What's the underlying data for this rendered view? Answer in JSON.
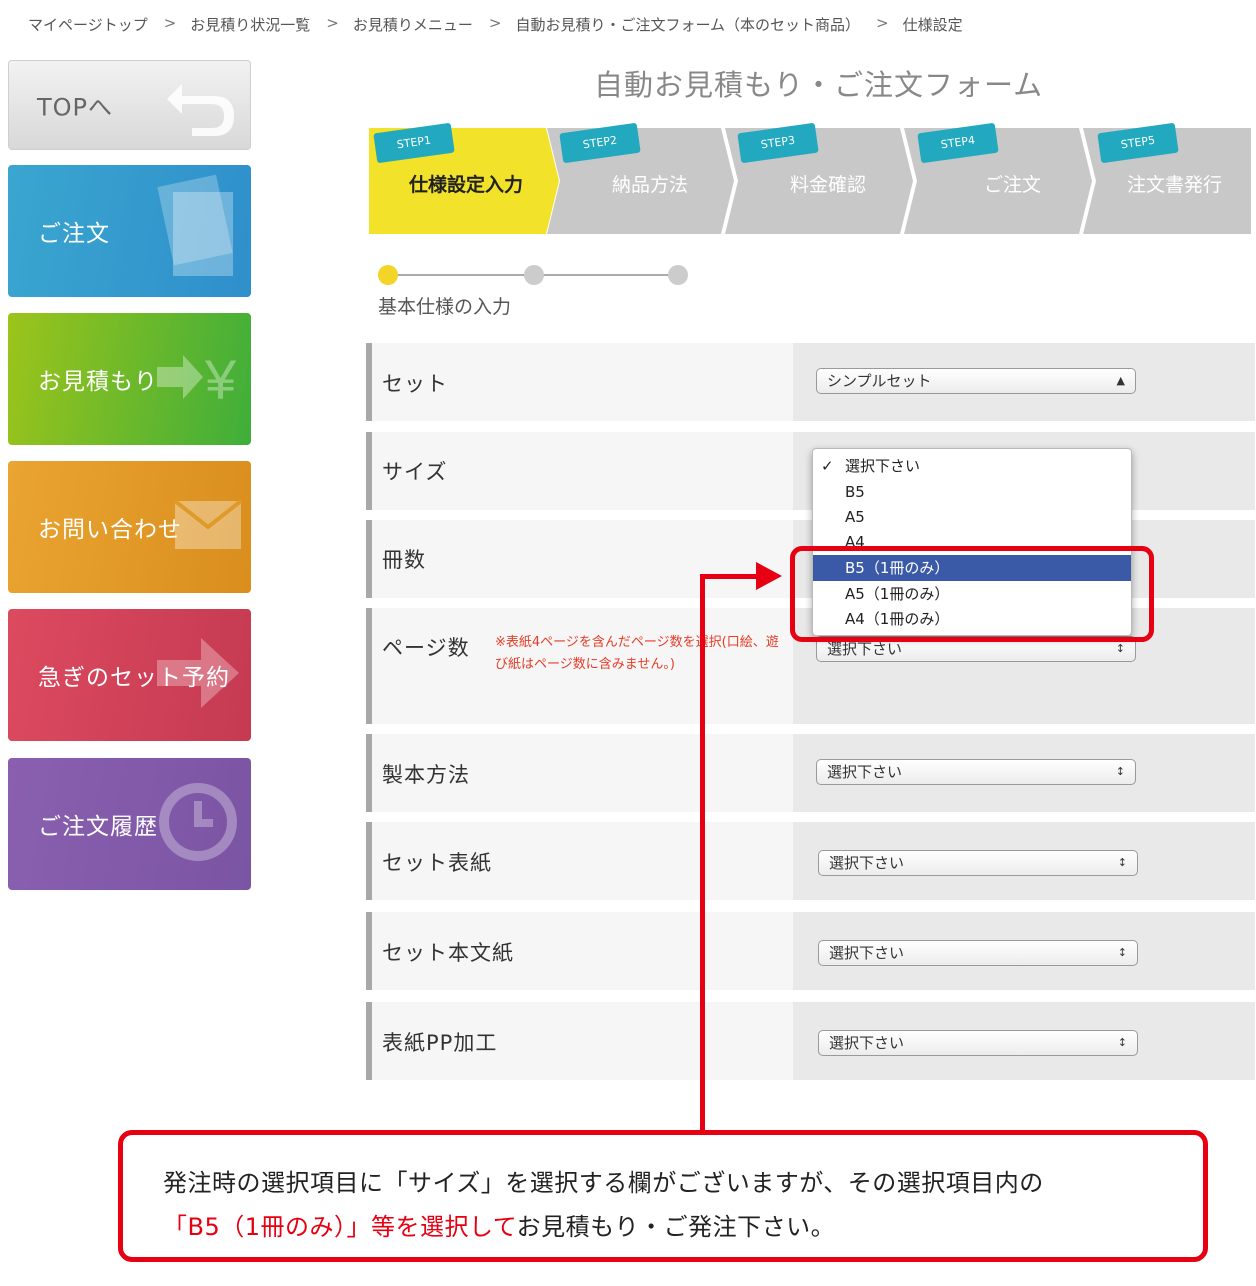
{
  "breadcrumb": {
    "items": [
      "マイページトップ",
      "お見積り状況一覧",
      "お見積りメニュー",
      "自動お見積り・ご注文フォーム（本のセット商品）",
      "仕様設定"
    ],
    "separator": ">"
  },
  "sidebar": {
    "top": "TOPへ",
    "order": "ご注文",
    "estimate": "お見積もり",
    "inquiry": "お問い合わせ",
    "rush": "急ぎのセット予約",
    "history": "ご注文履歴"
  },
  "page_title": "自動お見積もり・ご注文フォーム",
  "steps": [
    {
      "tag": "STEP1",
      "label": "仕様設定入力",
      "active": true
    },
    {
      "tag": "STEP2",
      "label": "納品方法",
      "active": false
    },
    {
      "tag": "STEP3",
      "label": "料金確認",
      "active": false
    },
    {
      "tag": "STEP4",
      "label": "ご注文",
      "active": false
    },
    {
      "tag": "STEP5",
      "label": "注文書発行",
      "active": false
    }
  ],
  "progress": {
    "label": "基本仕様の入力",
    "current": 1,
    "total": 3
  },
  "form": {
    "set": {
      "label": "セット",
      "value": "シンプルセット"
    },
    "size": {
      "label": "サイズ"
    },
    "copies": {
      "label": "冊数"
    },
    "pages": {
      "label": "ページ数",
      "value": "選択下さい",
      "note": "※表紙4ページを含んだページ数を選択(口絵、遊び紙はページ数に含みません。)"
    },
    "binding": {
      "label": "製本方法",
      "value": "選択下さい"
    },
    "cover": {
      "label": "セット表紙",
      "value": "選択下さい"
    },
    "body_paper": {
      "label": "セット本文紙",
      "value": "選択下さい"
    },
    "pp": {
      "label": "表紙PP加工",
      "value": "選択下さい"
    }
  },
  "size_dropdown": {
    "options": [
      "選択下さい",
      "B5",
      "A5",
      "A4",
      "B5（1冊のみ）",
      "A5（1冊のみ）",
      "A4（1冊のみ）"
    ],
    "checked": "選択下さい",
    "highlighted": "B5（1冊のみ）",
    "check_mark": "✓"
  },
  "callout": {
    "line1": "発注時の選択項目に「サイズ」を選択する欄がございますが、その選択項目内の",
    "line2_red": "「B5（1冊のみ）」等を選択して",
    "line2_rest": "お見積もり・ご発注下さい。"
  },
  "colors": {
    "accent_red": "#e60012",
    "step_active": "#f2e22a",
    "step_inactive": "#c8c8c8",
    "step_tag": "#22a9bf"
  }
}
